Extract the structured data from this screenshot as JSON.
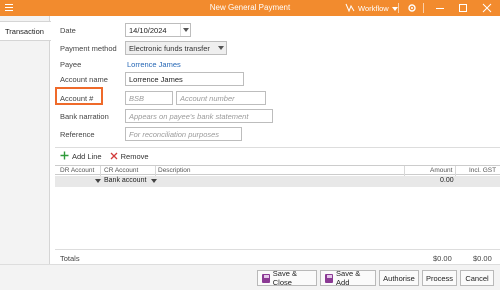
{
  "window": {
    "title": "New General Payment",
    "workflow_label": "Workflow"
  },
  "tabs": [
    {
      "label": "Transaction"
    }
  ],
  "form": {
    "date": {
      "label": "Date",
      "value": "14/10/2024"
    },
    "payment_method": {
      "label": "Payment method",
      "value": "Electronic funds transfer"
    },
    "payee": {
      "label": "Payee",
      "value": "Lorrence James"
    },
    "account_name": {
      "label": "Account name",
      "value": "Lorrence James"
    },
    "account_no": {
      "label": "Account #",
      "bsb_placeholder": "BSB",
      "number_placeholder": "Account number"
    },
    "bank_narration": {
      "label": "Bank narration",
      "placeholder": "Appears on payee's bank statement"
    },
    "reference": {
      "label": "Reference",
      "placeholder": "For reconciliation purposes"
    }
  },
  "grid": {
    "toolbar": {
      "add_line": "Add Line",
      "remove": "Remove"
    },
    "columns": [
      "DR Account",
      "CR Account",
      "Description",
      "Amount",
      "Incl. GST"
    ],
    "rows": [
      {
        "account": "Bank account",
        "amount": "0.00"
      }
    ],
    "totals": {
      "label": "Totals",
      "amount": "$0.00",
      "incl_gst": "$0.00"
    }
  },
  "footer": {
    "save_close": "Save & Close",
    "save_add": "Save & Add",
    "authorise": "Authorise",
    "process": "Process",
    "cancel": "Cancel"
  },
  "colors": {
    "titlebar": "#f28b2e",
    "highlight": "#ef6a2a",
    "link": "#2466b5",
    "save_icon": "#8b3a94"
  }
}
